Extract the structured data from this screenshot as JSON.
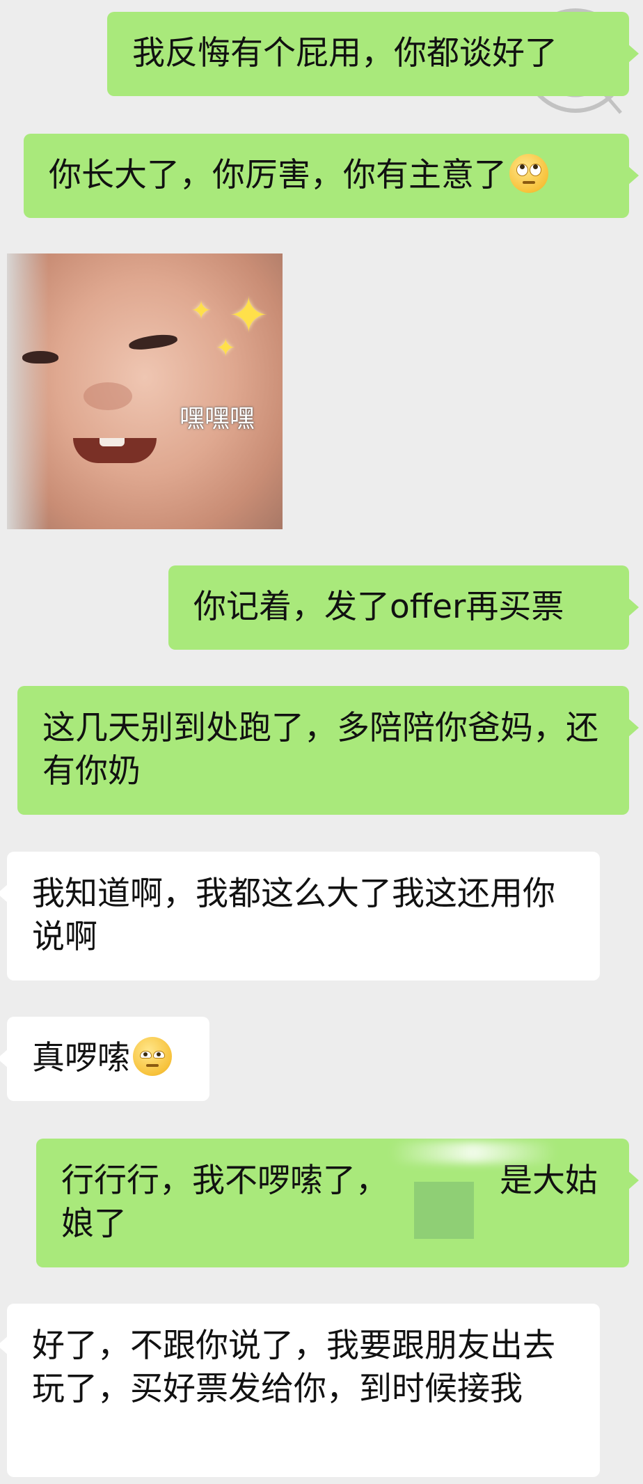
{
  "messages": [
    {
      "id": "m1",
      "side": "sent",
      "text": "我反悔有个屁用，你都谈好了"
    },
    {
      "id": "m2",
      "side": "sent",
      "text": "你长大了，你厉害，你有主意了",
      "emoji": "face-with-rolling-eyes-emoji"
    },
    {
      "id": "m3",
      "side": "recv",
      "type": "sticker",
      "sticker_caption": "嘿嘿嘿"
    },
    {
      "id": "m4",
      "side": "sent",
      "text": "你记着，发了offer再买票"
    },
    {
      "id": "m5",
      "side": "sent",
      "text": "这几天别到处跑了，多陪陪你爸妈，还有你奶"
    },
    {
      "id": "m6",
      "side": "recv",
      "text": "我知道啊，我都这么大了我这还用你说啊"
    },
    {
      "id": "m7",
      "side": "recv",
      "text": "真啰嗦",
      "emoji": "unamused-face-emoji"
    },
    {
      "id": "m8",
      "side": "sent",
      "text_before": "行行行，我不啰嗦了，",
      "text_after": "是大姑娘了"
    },
    {
      "id": "m9",
      "side": "recv",
      "text": "好了，不跟你说了，我要跟朋友出去玩了，买好票发给你，到时候接我"
    }
  ],
  "colors": {
    "background": "#ededed",
    "sent_bubble": "#a9e97b",
    "received_bubble": "#ffffff",
    "text": "#111111"
  }
}
